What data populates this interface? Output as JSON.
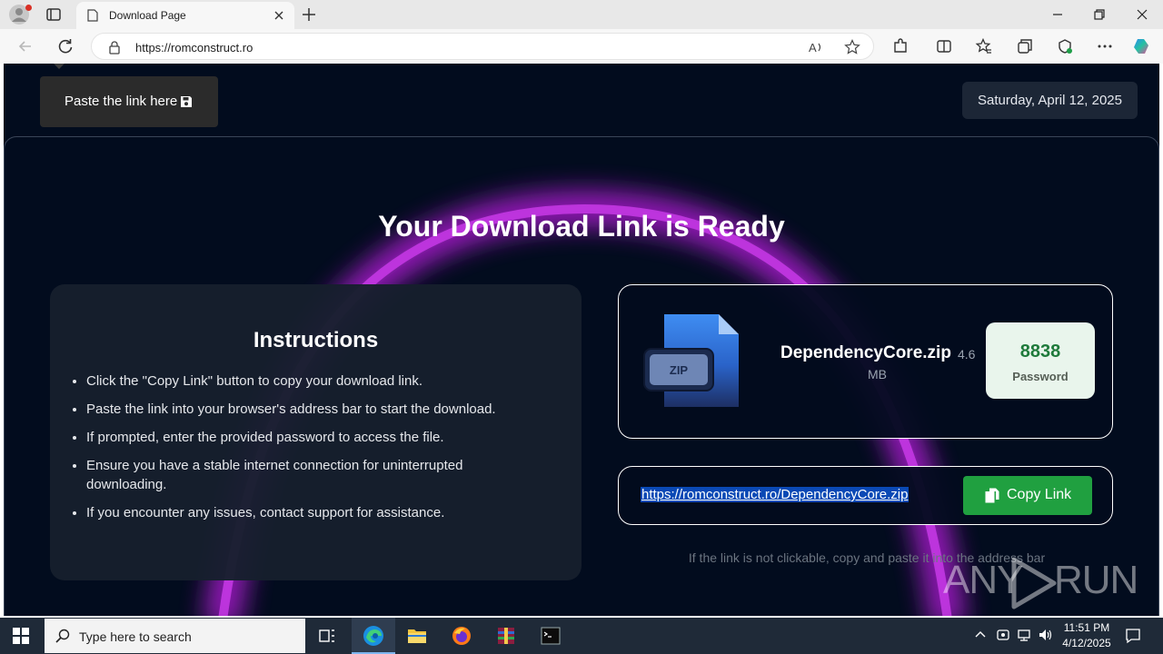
{
  "browser": {
    "tab_title": "Download Page",
    "url": "https://romconstruct.ro"
  },
  "page": {
    "paste_button_label": "Paste the link here",
    "date": "Saturday, April 12, 2025",
    "headline": "Your Download Link is Ready",
    "instructions": {
      "title": "Instructions",
      "items": [
        "Click the \"Copy Link\" button to copy your download link.",
        "Paste the link into your browser's address bar to start the download.",
        "If prompted, enter the provided password to access the file.",
        "Ensure you have a stable internet connection for uninterrupted downloading.",
        "If you encounter any issues, contact support for assistance."
      ]
    },
    "file": {
      "name": "DependencyCore.zip",
      "size_num": "4.6",
      "size_unit": "MB",
      "icon_label": "ZIP",
      "password": "8838",
      "password_label": "Password"
    },
    "link": {
      "url": "https://romconstruct.ro/DependencyCore.zip",
      "copy_label": "Copy Link"
    },
    "hint": "If the link is not clickable, copy and paste it into the address bar",
    "watermark": {
      "left": "ANY",
      "right": "RUN"
    }
  },
  "taskbar": {
    "search_placeholder": "Type here to search",
    "time": "11:51 PM",
    "date": "4/12/2025"
  }
}
